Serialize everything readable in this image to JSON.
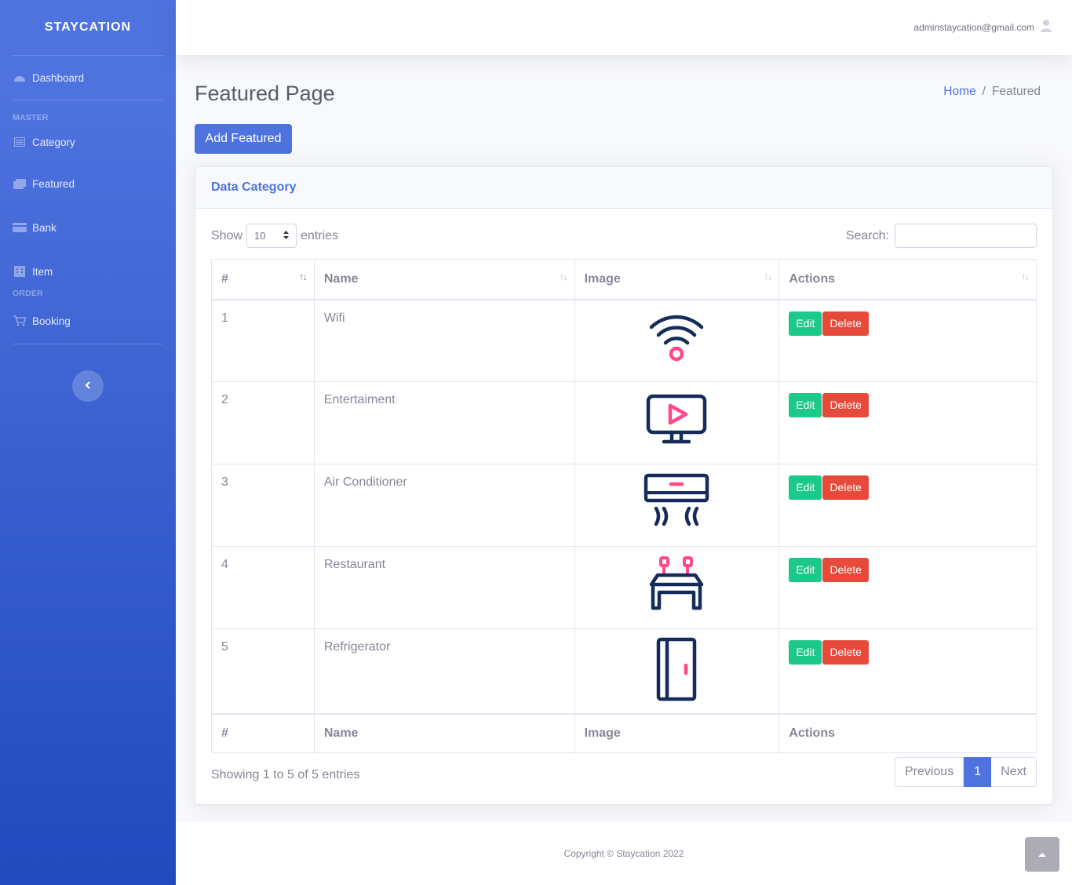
{
  "brand": "STAYCATION",
  "sidebar": {
    "dashboard": "Dashboard",
    "heading_master": "MASTER",
    "category": "Category",
    "featured": "Featured",
    "bank": "Bank",
    "item": "Item",
    "heading_order": "ORDER",
    "booking": "Booking"
  },
  "topbar": {
    "user_email": "adminstaycation@gmail.com"
  },
  "page": {
    "title": "Featured Page",
    "breadcrumb_home": "Home",
    "breadcrumb_sep": "/",
    "breadcrumb_active": "Featured",
    "add_button": "Add Featured"
  },
  "card": {
    "header": "Data Category",
    "show_label": "Show",
    "entries_label": "entries",
    "page_size": "10",
    "search_label": "Search:",
    "columns": [
      "#",
      "Name",
      "Image",
      "Actions"
    ],
    "rows": [
      {
        "no": "1",
        "name": "Wifi",
        "icon": "wifi-icon"
      },
      {
        "no": "2",
        "name": "Entertaiment",
        "icon": "tv-icon"
      },
      {
        "no": "3",
        "name": "Air Conditioner",
        "icon": "air-conditioner-icon"
      },
      {
        "no": "4",
        "name": "Restaurant",
        "icon": "restaurant-table-icon"
      },
      {
        "no": "5",
        "name": "Refrigerator",
        "icon": "refrigerator-icon"
      }
    ],
    "edit_label": "Edit",
    "delete_label": "Delete",
    "info": "Showing 1 to 5 of 5 entries",
    "pager": {
      "previous": "Previous",
      "current": "1",
      "next": "Next"
    }
  },
  "footer": {
    "copyright": "Copyright © Staycation 2022"
  },
  "colors": {
    "primary": "#4e73df",
    "success": "#1cc88a",
    "danger": "#e74a3b",
    "icon_navy": "#152c5b",
    "icon_pink": "#ff498b"
  }
}
